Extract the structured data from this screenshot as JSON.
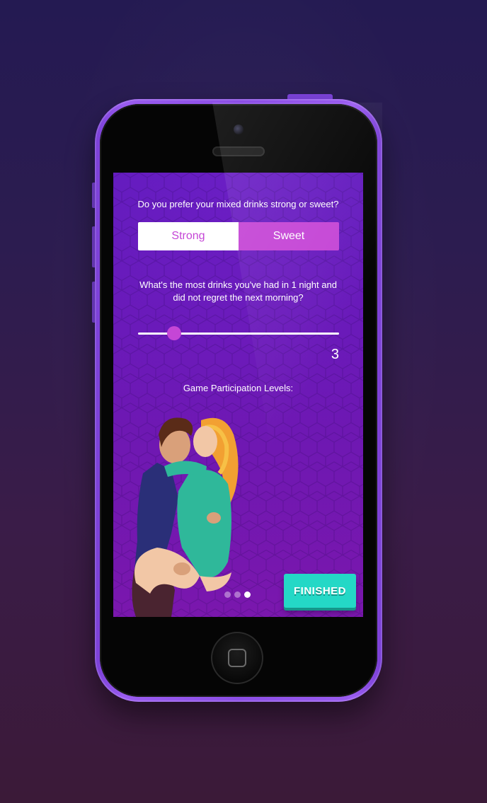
{
  "screen": {
    "question_drinks": "Do you prefer your mixed drinks strong or sweet?",
    "option_strong": "Strong",
    "option_sweet": "Sweet",
    "selected_option": "Sweet",
    "question_max_drinks": "What's the most drinks you've had in 1 night and did not regret the next morning?",
    "slider_value": "3",
    "slider_fraction": 0.18,
    "question_participation": "Game Participation Levels:",
    "illustration_icon": "couple-kissing-illustration",
    "pager": {
      "count": 3,
      "active_index": 2
    },
    "finished_label": "FINISHED"
  },
  "colors": {
    "accent": "#c546d6",
    "finished_button": "#24d8c6",
    "screen_bg": "#6a18b4",
    "phone_body": "#8c4ee6"
  }
}
